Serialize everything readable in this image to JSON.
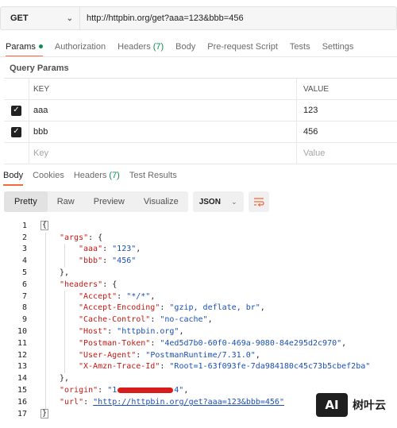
{
  "request": {
    "method": "GET",
    "url": "http://httpbin.org/get?aaa=123&bbb=456"
  },
  "request_tabs": [
    {
      "label": "Params",
      "active": true,
      "indicator": "dot"
    },
    {
      "label": "Authorization"
    },
    {
      "label": "Headers",
      "count": "(7)"
    },
    {
      "label": "Body"
    },
    {
      "label": "Pre-request Script"
    },
    {
      "label": "Tests"
    },
    {
      "label": "Settings"
    }
  ],
  "query_params": {
    "title": "Query Params",
    "headers": {
      "key": "KEY",
      "value": "VALUE"
    },
    "rows": [
      {
        "checked": true,
        "key": "aaa",
        "value": "123"
      },
      {
        "checked": true,
        "key": "bbb",
        "value": "456"
      }
    ],
    "placeholder": {
      "key": "Key",
      "value": "Value"
    }
  },
  "response_tabs": [
    {
      "label": "Body",
      "active": true
    },
    {
      "label": "Cookies"
    },
    {
      "label": "Headers",
      "count": "(7)"
    },
    {
      "label": "Test Results"
    }
  ],
  "view_modes": [
    "Pretty",
    "Raw",
    "Preview",
    "Visualize"
  ],
  "format": "JSON",
  "colors": {
    "accent": "#f26b3a",
    "green": "#0f8a52",
    "key": "#c41a16",
    "string": "#1a4fb8",
    "redaction": "#d71c1c"
  },
  "code": {
    "line_numbers": [
      "1",
      "2",
      "3",
      "4",
      "5",
      "6",
      "7",
      "8",
      "9",
      "10",
      "11",
      "12",
      "13",
      "14",
      "15",
      "16",
      "17"
    ],
    "brace_open": "{",
    "brace_close": "}",
    "args_key": "\"args\"",
    "aaa_key": "\"aaa\"",
    "aaa_val": "\"123\"",
    "bbb_key": "\"bbb\"",
    "bbb_val": "\"456\"",
    "headers_key": "\"headers\"",
    "accept_key": "\"Accept\"",
    "accept_val": "\"*/*\"",
    "accept_enc_key": "\"Accept-Encoding\"",
    "accept_enc_val": "\"gzip, deflate, br\"",
    "cache_key": "\"Cache-Control\"",
    "cache_val": "\"no-cache\"",
    "host_key": "\"Host\"",
    "host_val": "\"httpbin.org\"",
    "token_key": "\"Postman-Token\"",
    "token_val": "\"4ed5d7b0-60f0-469a-9080-84e295d2c970\"",
    "ua_key": "\"User-Agent\"",
    "ua_val": "\"PostmanRuntime/7.31.0\"",
    "trace_key": "\"X-Amzn-Trace-Id\"",
    "trace_val": "\"Root=1-63f093fe-7da984180c45c73b5cbef2ba\"",
    "origin_key": "\"origin\"",
    "origin_val_start": "\"1",
    "origin_val_end": "4\"",
    "url_key": "\"url\"",
    "url_val": "\"http://httpbin.org/get?aaa=123&bbb=456\""
  },
  "watermark": {
    "logo": "AI",
    "text": "树叶云"
  }
}
